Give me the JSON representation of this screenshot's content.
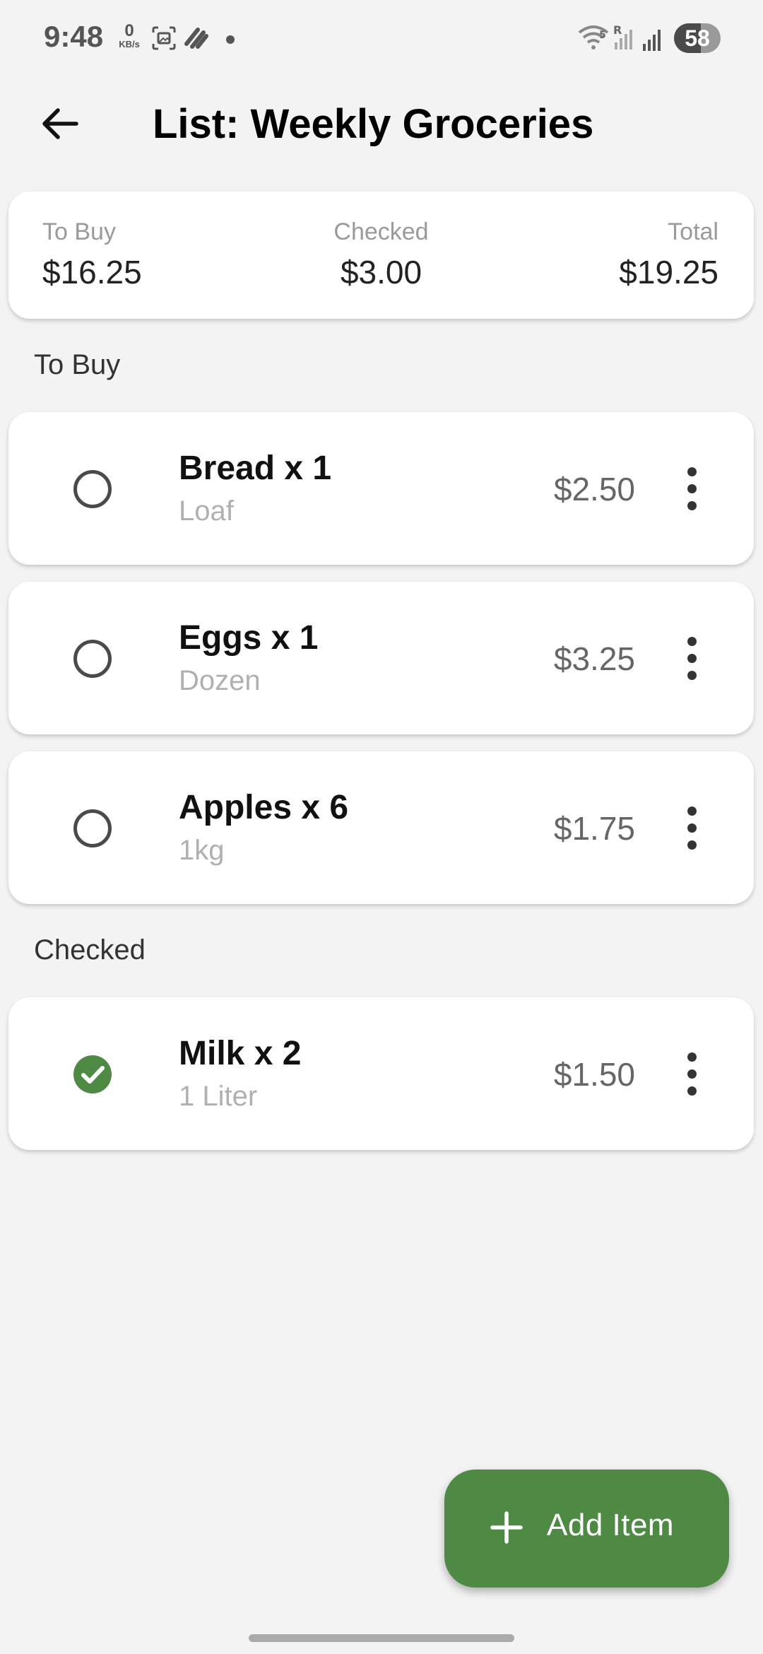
{
  "status_bar": {
    "time": "9:48",
    "speed_value": "0",
    "speed_unit": "KB/s",
    "roaming_label": "R",
    "wifi_label": "5",
    "battery_level": "58"
  },
  "header": {
    "title": "List: Weekly Groceries"
  },
  "summary": {
    "to_buy_label": "To Buy",
    "to_buy_value": "$16.25",
    "checked_label": "Checked",
    "checked_value": "$3.00",
    "total_label": "Total",
    "total_value": "$19.25"
  },
  "sections": {
    "to_buy_heading": "To Buy",
    "checked_heading": "Checked"
  },
  "to_buy_items": [
    {
      "name": "Bread x 1",
      "unit": "Loaf",
      "price": "$2.50",
      "checked": false
    },
    {
      "name": "Eggs x 1",
      "unit": "Dozen",
      "price": "$3.25",
      "checked": false
    },
    {
      "name": "Apples x 6",
      "unit": "1kg",
      "price": "$1.75",
      "checked": false
    }
  ],
  "checked_items": [
    {
      "name": "Milk x 2",
      "unit": "1 Liter",
      "price": "$1.50",
      "checked": true
    }
  ],
  "fab": {
    "label": "Add Item",
    "icon": "plus-icon"
  },
  "colors": {
    "accent": "#4f8a45",
    "background": "#f3f3f3",
    "card": "#ffffff"
  }
}
